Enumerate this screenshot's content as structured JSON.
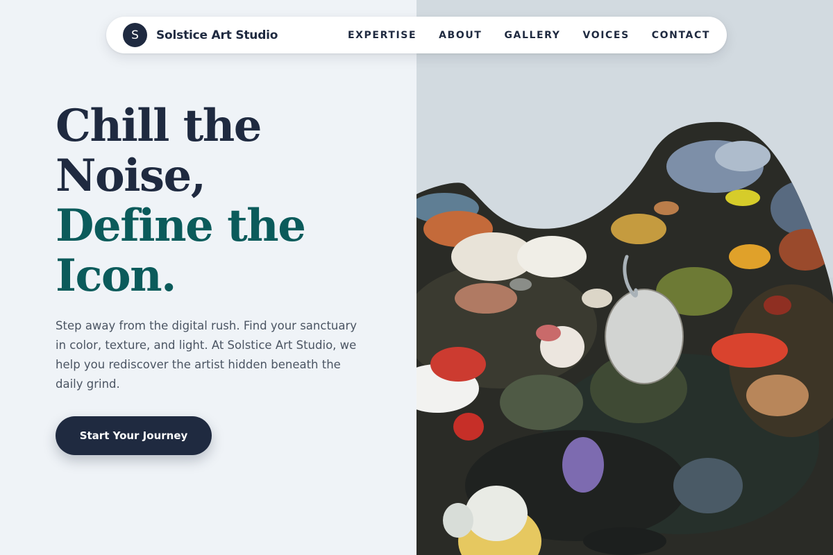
{
  "brand": {
    "logo_letter": "S",
    "name": "Solstice Art Studio"
  },
  "nav": {
    "items": [
      {
        "label": "EXPERTISE"
      },
      {
        "label": "ABOUT"
      },
      {
        "label": "GALLERY"
      },
      {
        "label": "VOICES"
      },
      {
        "label": "CONTACT"
      }
    ]
  },
  "hero": {
    "headline_line_1": "Chill the",
    "headline_line_2": "Noise,",
    "headline_line_3": "Define the",
    "headline_line_4": "Icon.",
    "description": "Step away from the digital rush. Find your sanctuary in color, texture, and light. At Solstice Art Studio, we help you rediscover the artist hidden beneath the daily grind.",
    "cta_label": "Start Your Journey"
  },
  "colors": {
    "navy": "#1f2a40",
    "teal": "#0b5b5b",
    "page_background": "#eff3f7",
    "body_text": "#4b5563"
  }
}
